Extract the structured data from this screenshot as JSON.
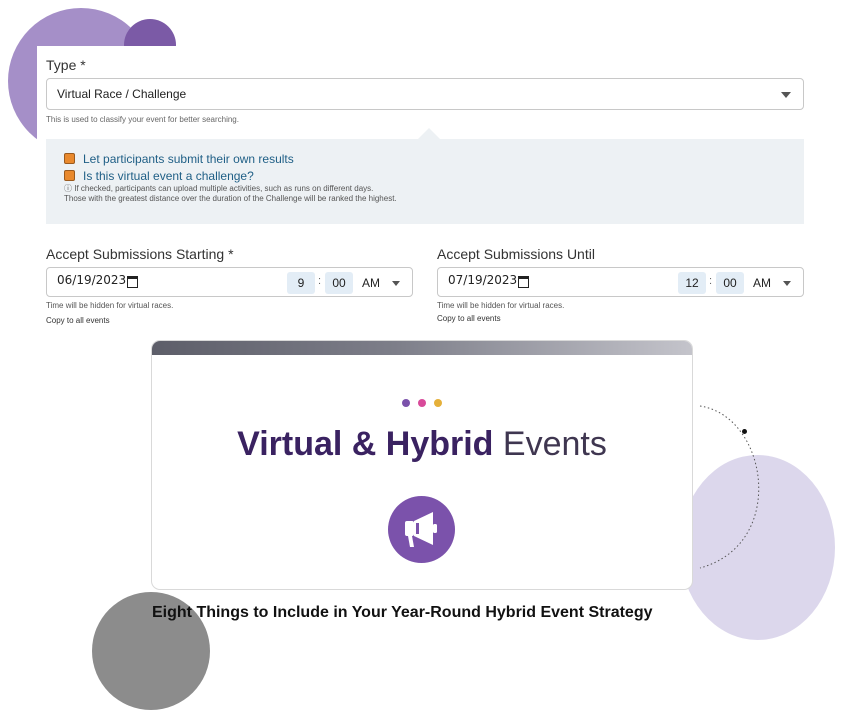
{
  "form": {
    "type_label": "Type *",
    "type_value": "Virtual Race / Challenge",
    "type_hint": "This is used to classify your event for better searching.",
    "checkbox_1": "Let participants submit their own results",
    "checkbox_2": "Is this virtual event a challenge?",
    "challenge_note_line1": "If checked, participants can upload multiple activities, such as runs on different days.",
    "challenge_note_line2": "Those with the greatest distance over the duration of the Challenge will be ranked the highest.",
    "start": {
      "label": "Accept Submissions Starting *",
      "date": "06/19/2023",
      "hour": "9",
      "minute": "00",
      "ampm": "AM",
      "hint": "Time will be hidden for virtual races.",
      "copy": "Copy to all events"
    },
    "until": {
      "label": "Accept Submissions Until",
      "date": "07/19/2023",
      "hour": "12",
      "minute": "00",
      "ampm": "AM",
      "hint": "Time will be hidden for virtual races.",
      "copy": "Copy to all events"
    }
  },
  "card": {
    "title_bold": "Virtual & Hybrid",
    "title_rest": " Events",
    "dot_colors": [
      "#7b52ab",
      "#d84a9a",
      "#e5b03a"
    ],
    "icon": "megaphone-icon"
  },
  "article_title": "Eight Things to Include in Your Year-Round Hybrid Event Strategy",
  "colors": {
    "accent_purple": "#7b52ab",
    "checkbox_orange": "#e9892d",
    "panel_gray": "#edf1f4"
  }
}
